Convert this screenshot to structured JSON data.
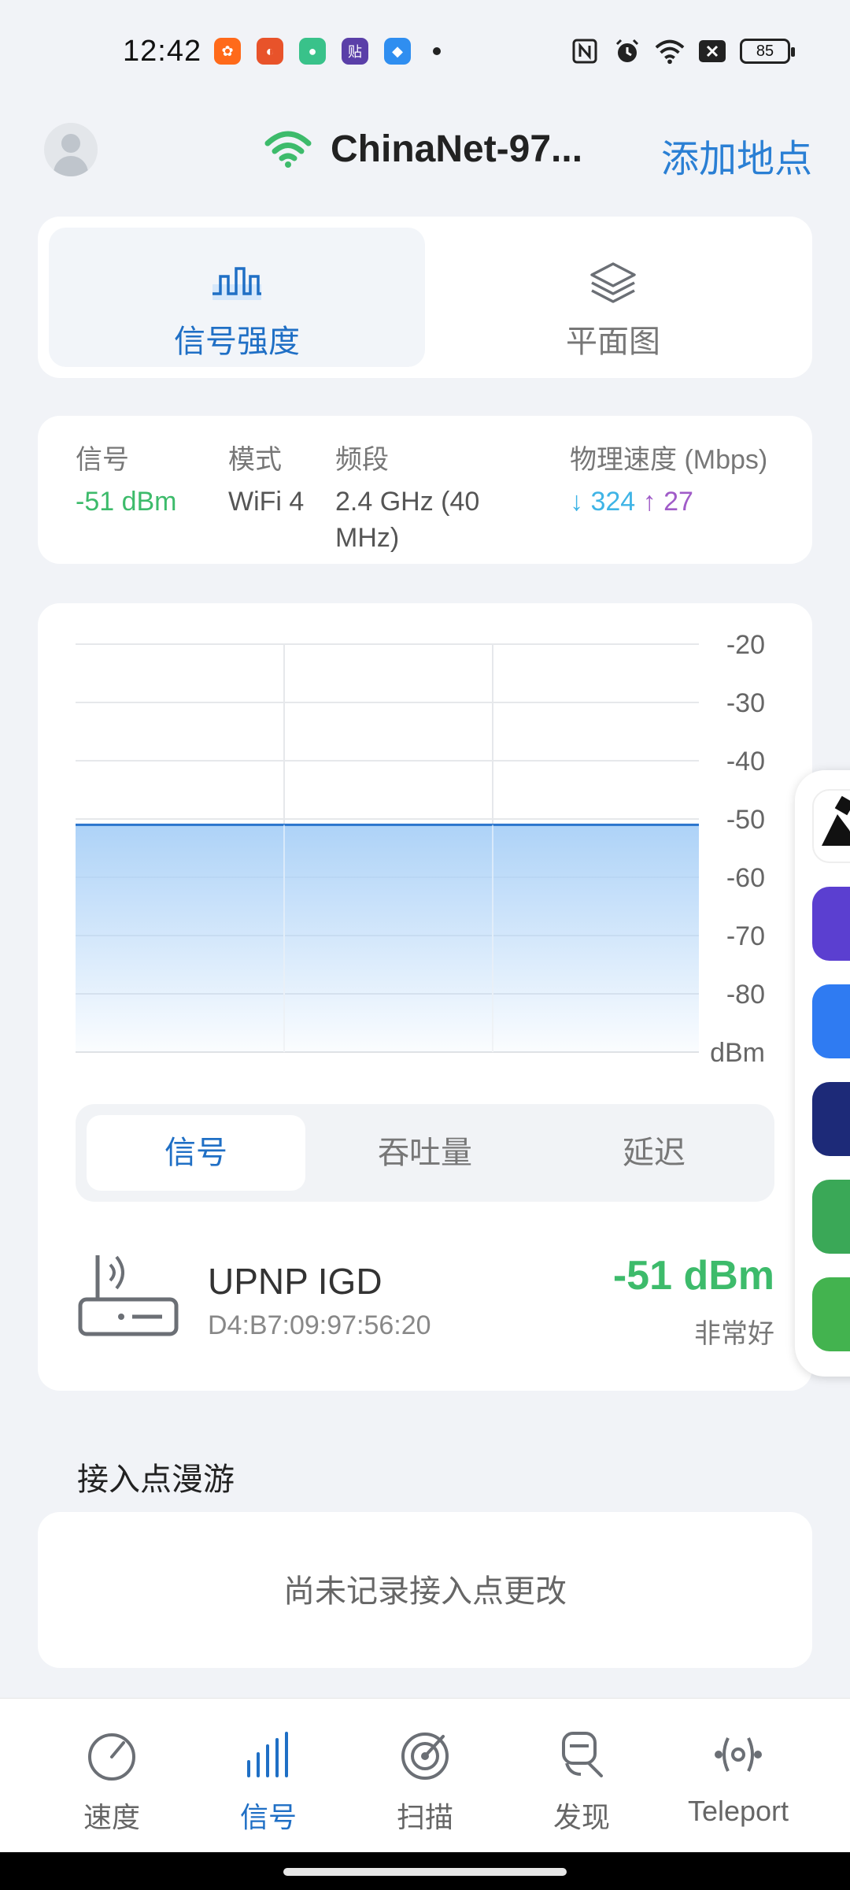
{
  "status_bar": {
    "time": "12:42",
    "battery": "85",
    "app_icons": [
      "app-orange-icon",
      "app-red-icon",
      "app-green-icon",
      "app-purple-tie-icon",
      "app-blue-icon"
    ],
    "status_icons": [
      "nfc-icon",
      "alarm-icon",
      "wifi-icon",
      "x-icon"
    ]
  },
  "header": {
    "network_name": "ChinaNet-97...",
    "add_place": "添加地点"
  },
  "top_tabs": [
    {
      "label": "信号强度",
      "icon": "signal-wave-icon",
      "active": true
    },
    {
      "label": "平面图",
      "icon": "layers-icon",
      "active": false
    }
  ],
  "info": {
    "signal_label": "信号",
    "signal_value": "-51 dBm",
    "mode_label": "模式",
    "mode_value": "WiFi 4",
    "band_label": "频段",
    "band_value_line1": "2.4 GHz (40",
    "band_value_line2": "MHz)",
    "speed_label": "物理速度 (Mbps)",
    "speed_down": "↓ 324",
    "speed_up": "↑ 27"
  },
  "chart_data": {
    "type": "area",
    "y_ticks": [
      "-20",
      "-30",
      "-40",
      "-50",
      "-60",
      "-70",
      "-80"
    ],
    "y_unit": "dBm",
    "ylim": [
      -90,
      -20
    ],
    "series": [
      {
        "values": [
          -51,
          -51,
          -51,
          -51
        ]
      }
    ],
    "line_color": "#2a74cc",
    "fill_color": "#a9d0f7"
  },
  "segment_tabs": [
    {
      "label": "信号",
      "active": true
    },
    {
      "label": "吞吐量",
      "active": false
    },
    {
      "label": "延迟",
      "active": false
    }
  ],
  "device": {
    "name": "UPNP IGD",
    "mac": "D4:B7:09:97:56:20",
    "signal": "-51 dBm",
    "quality": "非常好"
  },
  "roaming": {
    "title": "接入点漫游",
    "empty_text": "尚未记录接入点更改"
  },
  "bottom_nav": [
    {
      "label": "速度",
      "icon": "speedometer-icon",
      "active": false
    },
    {
      "label": "信号",
      "icon": "signal-bars-icon",
      "active": true
    },
    {
      "label": "扫描",
      "icon": "radar-icon",
      "active": false
    },
    {
      "label": "发现",
      "icon": "discover-icon",
      "active": false
    },
    {
      "label": "Teleport",
      "icon": "teleport-icon",
      "active": false
    }
  ]
}
